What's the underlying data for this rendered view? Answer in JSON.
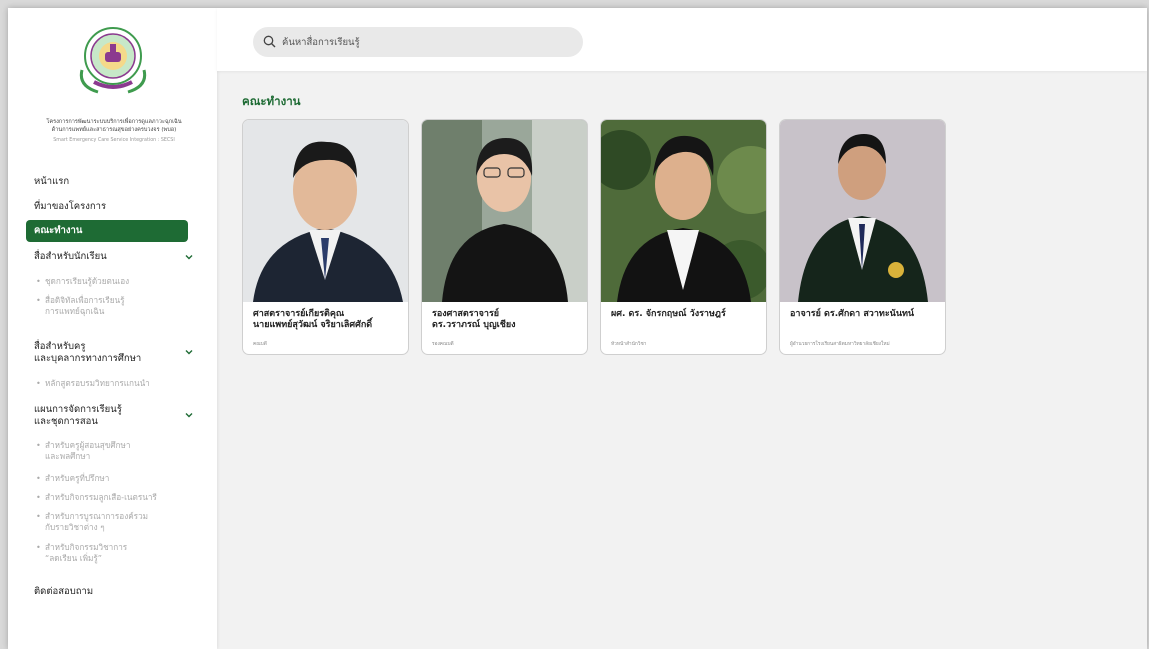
{
  "search": {
    "placeholder": "ค้นหาสื่อการเรียนรู้"
  },
  "org": {
    "name_line1": "โครงการการพัฒนาระบบบริการเพื่อการดูแลภาวะฉุกเฉิน",
    "name_line2": "ด้านการแพทย์และสาธารณสุขอย่างครบวงจร (พบอ)",
    "name_en": "Smart Emergency Care Service Integration : SECSI"
  },
  "nav": {
    "home": "หน้าแรก",
    "about": "ที่มาของโครงการ",
    "team": "คณะทำงาน",
    "students": {
      "label": "สื่อสำหรับนักเรียน",
      "items": [
        [
          "ชุดการเรียนรู้ด้วยตนเอง"
        ],
        [
          "สื่อดิจิทัลเพื่อการเรียนรู้",
          "การแพทย์ฉุกเฉิน"
        ]
      ]
    },
    "teachers": {
      "label_line1": "สื่อสำหรับครู",
      "label_line2": "และบุคลากรทางการศึกษา",
      "items": [
        [
          "หลักสูตรอบรมวิทยากรแกนนำ"
        ]
      ]
    },
    "plans": {
      "label_line1": "แผนการจัดการเรียนรู้",
      "label_line2": "และชุดการสอน",
      "items": [
        [
          "สำหรับครูผู้สอนสุขศึกษา",
          "และพลศึกษา"
        ],
        [
          "สำหรับครูที่ปรึกษา"
        ],
        [
          "สำหรับกิจกรรมลูกเสือ-เนตรนารี"
        ],
        [
          "สำหรับการบูรณาการองค์รวม",
          "กับรายวิชาต่าง ๆ"
        ],
        [
          "สำหรับกิจกรรมวิชาการ",
          "“ลดเรียน เพิ่มรู้”"
        ]
      ]
    },
    "contact": "ติดต่อสอบถาม"
  },
  "main": {
    "title": "คณะทำงาน",
    "cards": [
      {
        "name_line1": "ศาสตราจารย์เกียรติคุณ",
        "name_line2": "นายแพทย์สุวัฒน์ จริยาเลิศศักดิ์",
        "role": "คณบดี"
      },
      {
        "name_line1": "รองศาสตราจารย์",
        "name_line2": "ดร.วราภรณ์ บุญเชียง",
        "role": "รองคณบดี"
      },
      {
        "name_line1": "ผศ. ดร. จักรกฤษณ์ วังราษฎร์",
        "name_line2": "",
        "role": "หัวหน้าสำนักวิชา"
      },
      {
        "name_line1": "อาจารย์ ดร.ศักดา สวาทะนันทน์",
        "name_line2": "",
        "role": "ผู้อำนวยการโรงเรียนสาธิตมหาวิทยาลัยเชียงใหม่"
      }
    ]
  },
  "colors": {
    "accent": "#1e6b34",
    "sub_text": "#aaaaaa"
  }
}
